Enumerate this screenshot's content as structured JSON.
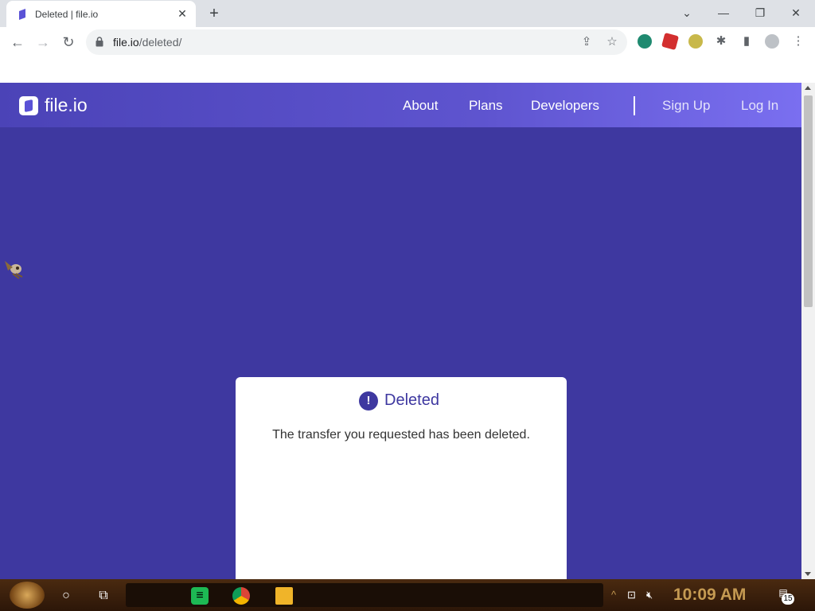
{
  "browser": {
    "tab_title": "Deleted | file.io",
    "tab_close_icon": "close-icon",
    "new_tab_label": "+",
    "window_buttons": [
      "chevron-down-icon",
      "minimize-icon",
      "restore-icon",
      "close-icon"
    ],
    "url_host": "file.io",
    "url_path": "/deleted/"
  },
  "site": {
    "brand": "file.io",
    "nav": [
      "About",
      "Plans",
      "Developers"
    ],
    "auth": [
      "Sign Up",
      "Log In"
    ]
  },
  "card": {
    "icon": "!",
    "title": "Deleted",
    "message": "The transfer you requested has been deleted."
  },
  "taskbar": {
    "clock": "10:09 AM",
    "notification_count": "15"
  },
  "colors": {
    "page_bg": "#3e38a0",
    "header_gradient_end": "#7a6ff0",
    "card_bg": "#ffffff",
    "accent": "#3e38a0"
  }
}
